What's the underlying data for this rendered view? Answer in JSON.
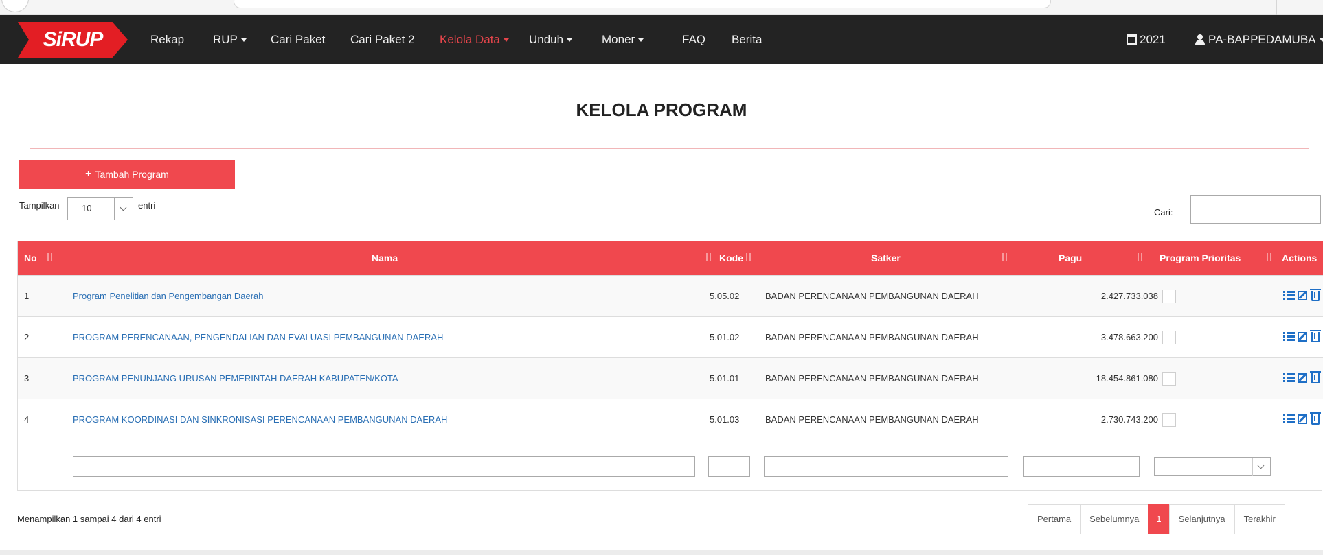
{
  "app": {
    "logo_text": "SiRUP",
    "brand_color": "#e31e24",
    "accent_color": "#f0484e"
  },
  "nav": {
    "items": [
      {
        "label": "Rekap",
        "caret": false
      },
      {
        "label": "RUP",
        "caret": true
      },
      {
        "label": "Cari Paket",
        "caret": false
      },
      {
        "label": "Cari Paket 2",
        "caret": false
      },
      {
        "label": "Kelola Data",
        "caret": true,
        "active": true
      },
      {
        "label": "Unduh",
        "caret": true
      },
      {
        "label": "Moner",
        "caret": true
      },
      {
        "label": "FAQ",
        "caret": false
      },
      {
        "label": "Berita",
        "caret": false
      }
    ],
    "year": "2021",
    "year_icon": "calendar-icon",
    "user": "PA-BAPPEDAMUBA",
    "user_icon": "user-icon"
  },
  "page": {
    "title": "KELOLA PROGRAM",
    "add_button": "Tambah Program",
    "length_prefix": "Tampilkan",
    "length_value": "10",
    "length_suffix": "entri",
    "search_label": "Cari:",
    "search_value": ""
  },
  "table": {
    "columns": [
      "No",
      "Nama",
      "Kode",
      "Satker",
      "Pagu",
      "Program Prioritas",
      "Actions"
    ],
    "rows": [
      {
        "no": "1",
        "nama": "Program Penelitian dan Pengembangan Daerah",
        "kode": "5.05.02",
        "satker": "BADAN PERENCANAAN PEMBANGUNAN DAERAH",
        "pagu": "2.427.733.038",
        "prioritas": false
      },
      {
        "no": "2",
        "nama": "PROGRAM PERENCANAAN, PENGENDALIAN DAN EVALUASI PEMBANGUNAN DAERAH",
        "kode": "5.01.02",
        "satker": "BADAN PERENCANAAN PEMBANGUNAN DAERAH",
        "pagu": "3.478.663.200",
        "prioritas": false
      },
      {
        "no": "3",
        "nama": "PROGRAM PENUNJANG URUSAN PEMERINTAH DAERAH KABUPATEN/KOTA",
        "kode": "5.01.01",
        "satker": "BADAN PERENCANAAN PEMBANGUNAN DAERAH",
        "pagu": "18.454.861.080",
        "prioritas": false
      },
      {
        "no": "4",
        "nama": "PROGRAM KOORDINASI DAN SINKRONISASI PERENCANAAN PEMBANGUNAN DAERAH",
        "kode": "5.01.03",
        "satker": "BADAN PERENCANAAN PEMBANGUNAN DAERAH",
        "pagu": "2.730.743.200",
        "prioritas": false
      }
    ],
    "action_icons": [
      "list-icon",
      "edit-icon",
      "trash-icon"
    ]
  },
  "footer": {
    "info": "Menampilkan 1 sampai 4 dari 4 entri",
    "pagination": [
      "Pertama",
      "Sebelumnya",
      "1",
      "Selanjutnya",
      "Terakhir"
    ],
    "current_page": "1"
  }
}
